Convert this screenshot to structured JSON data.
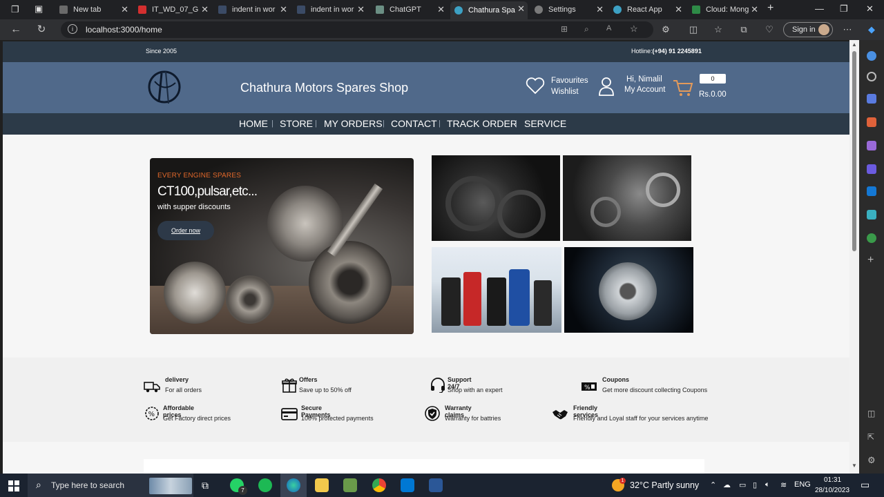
{
  "browser": {
    "tabs": [
      {
        "label": "New tab"
      },
      {
        "label": "IT_WD_07_G"
      },
      {
        "label": "indent in wor"
      },
      {
        "label": "indent in wor"
      },
      {
        "label": "ChatGPT"
      },
      {
        "label": "Chathura Spa"
      },
      {
        "label": "Settings"
      },
      {
        "label": "React App"
      },
      {
        "label": "Cloud: Mong"
      }
    ],
    "url": "localhost:3000/home",
    "sign_in": "Sign in"
  },
  "site": {
    "topbar": {
      "since": "Since 2005",
      "hotline_label": "Hotline:",
      "hotline_number": "(+94) 91 2245891"
    },
    "name": "Chathura Motors Spares Shop",
    "favourites": "Favourites",
    "wishlist": "Wishlist",
    "greeting": "Hi, Nimalil",
    "account": "My Account",
    "cart_count": "0",
    "cart_total": "Rs.0.00",
    "nav": [
      "HOME",
      "STORE",
      "MY ORDERS",
      "CONTACT",
      "TRACK ORDER",
      "SERVICE"
    ],
    "hero": {
      "kicker": "EVERY ENGINE SPARES",
      "title": "CT100,pulsar,etc...",
      "subtitle": "with supper discounts",
      "button": "Order now"
    },
    "features": [
      {
        "title": "delivery",
        "desc": "For all orders",
        "icon": "truck-icon"
      },
      {
        "title": "Offers",
        "desc": "Save up to 50% off",
        "icon": "gift-icon"
      },
      {
        "title": "Support 24/7",
        "desc": "Shop with an expert",
        "icon": "headset-icon"
      },
      {
        "title": "Coupons",
        "desc": "Get more discount collecting Coupons",
        "icon": "coupon-icon"
      },
      {
        "title": "Affordable prices",
        "desc": "Get Factory direct prices",
        "icon": "percent-badge-icon"
      },
      {
        "title": "Secure Payments",
        "desc": "100% protected payments",
        "icon": "card-icon"
      },
      {
        "title": "Warranty claims",
        "desc": "Warranty for battries",
        "icon": "shield-check-icon"
      },
      {
        "title": "Friendly services",
        "desc": "Friendly and Loyal staff for your services anytime",
        "icon": "handshake-icon"
      }
    ]
  },
  "taskbar": {
    "search_placeholder": "Type here to search",
    "weather": "32°C  Partly sunny",
    "lang": "ENG",
    "time": "01:31",
    "date": "28/10/2023",
    "whatsapp_badge": "7",
    "weather_badge": "1"
  }
}
